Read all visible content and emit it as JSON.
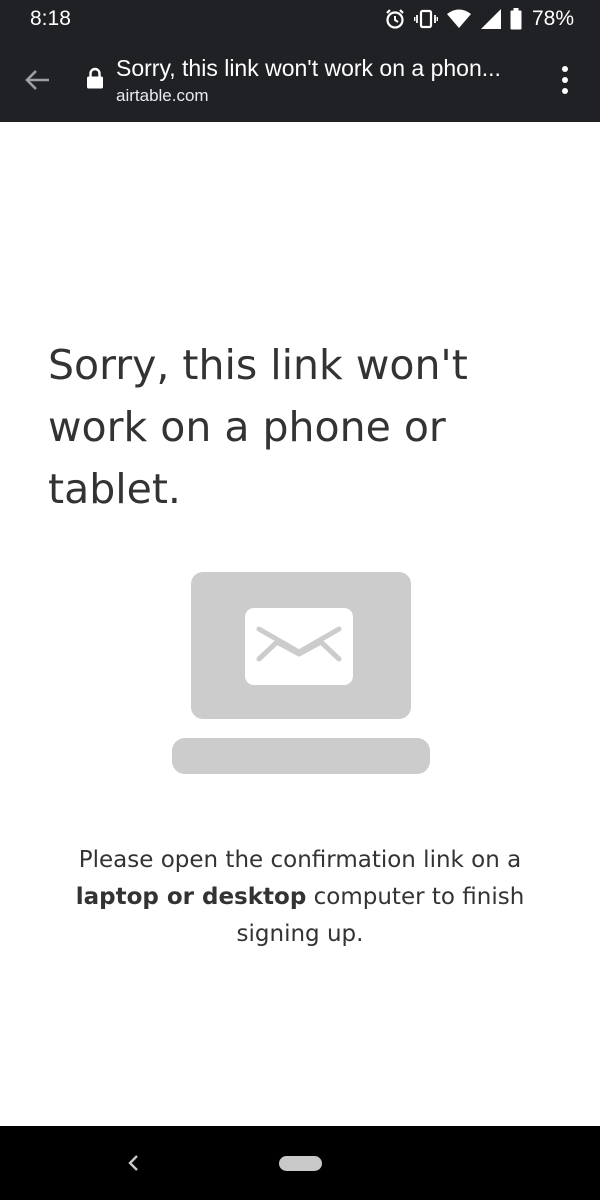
{
  "status_bar": {
    "time": "8:18",
    "battery_percent": "78%",
    "icons": [
      "alarm-icon",
      "vibrate-icon",
      "wifi-icon",
      "signal-icon",
      "battery-icon"
    ]
  },
  "browser": {
    "page_title": "Sorry, this link won't work on a phon...",
    "url_host": "airtable.com",
    "icons": [
      "back-arrow-icon",
      "lock-icon",
      "more-vert-icon"
    ]
  },
  "content": {
    "heading": "Sorry, this link won't work on a phone or tablet.",
    "message_part1": "Please open the confirmation link on a ",
    "message_bold": "laptop or desktop",
    "message_part2": " computer to finish signing up.",
    "illustration": "laptop-email-icon"
  },
  "nav_bar": {
    "icons": [
      "nav-back-icon",
      "nav-home-pill"
    ]
  },
  "colors": {
    "bar_background": "#202124",
    "illustration_gray": "#cccccc",
    "text": "#333333"
  }
}
